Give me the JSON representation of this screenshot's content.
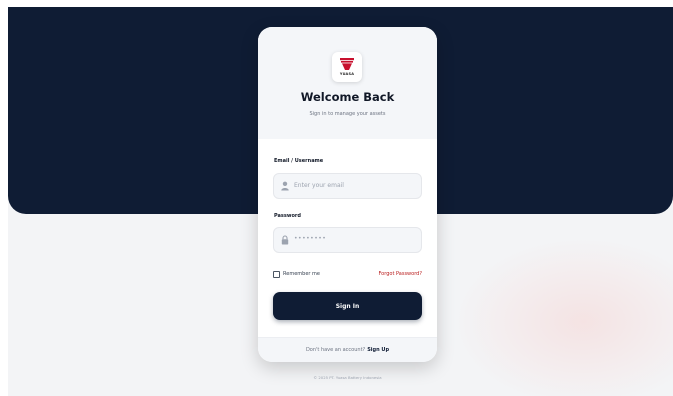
{
  "brand": {
    "logo_text": "YUASA",
    "accent": "#b91c1c",
    "navy": "#0f1c34"
  },
  "header": {
    "title": "Welcome Back",
    "subtitle": "Sign in to manage your assets"
  },
  "form": {
    "email_label": "Email / Username",
    "email_placeholder": "Enter your email",
    "password_label": "Password",
    "password_placeholder": "••••••••",
    "remember_label": "Remember me",
    "remember_checked": false,
    "forgot_label": "Forgot Password?",
    "submit_label": "Sign In"
  },
  "footer": {
    "prompt": "Don't have an account?",
    "signup_label": "Sign Up",
    "copyright": "© 2025 PT. Yuasa Battery Indonesia"
  },
  "icons": {
    "email_icon": "user-icon",
    "password_icon": "lock-icon"
  }
}
